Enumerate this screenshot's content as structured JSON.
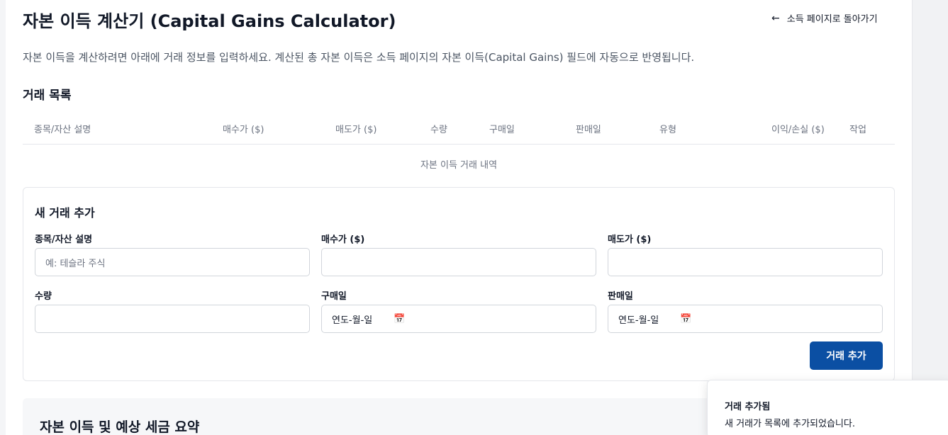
{
  "header": {
    "title": "자본 이득 계산기 (Capital Gains Calculator)",
    "back_icon": "arrow-left-icon",
    "back_label": "소득 페이지로 돌아가기"
  },
  "intro_text": "자본 이득을 계산하려면 아래에 거래 정보를 입력하세요. 계산된 총 자본 이득은 소득 페이지의 자본 이득(Capital Gains) 필드에 자동으로 반영됩니다.",
  "transactions": {
    "title": "거래 목록",
    "columns": [
      "종목/자산 설명",
      "매수가 ($)",
      "매도가 ($)",
      "수량",
      "구매일",
      "판매일",
      "유형",
      "이익/손실 ($)",
      "작업"
    ],
    "empty_text": "자본 이득 거래 내역"
  },
  "new_transaction": {
    "title": "새 거래 추가",
    "fields": {
      "description": {
        "label": "종목/자산 설명",
        "placeholder": "예: 테슬라 주식"
      },
      "buy_price": {
        "label": "매수가 ($)",
        "value": ""
      },
      "sell_price": {
        "label": "매도가 ($)",
        "value": ""
      },
      "quantity": {
        "label": "수량",
        "value": ""
      },
      "purchase_date": {
        "label": "구매일",
        "placeholder": "연도-월-일"
      },
      "sale_date": {
        "label": "판매일",
        "placeholder": "연도-월-일"
      }
    },
    "calendar_icon": "calendar-icon",
    "submit_label": "거래 추가"
  },
  "summary": {
    "title": "자본 이득 및 예상 세금 요약"
  },
  "toast": {
    "title": "거래 추가됨",
    "message": "새 거래가 목록에 추가되었습니다."
  },
  "colors": {
    "primary": "#0b4fa3",
    "border": "#e5e7eb"
  }
}
